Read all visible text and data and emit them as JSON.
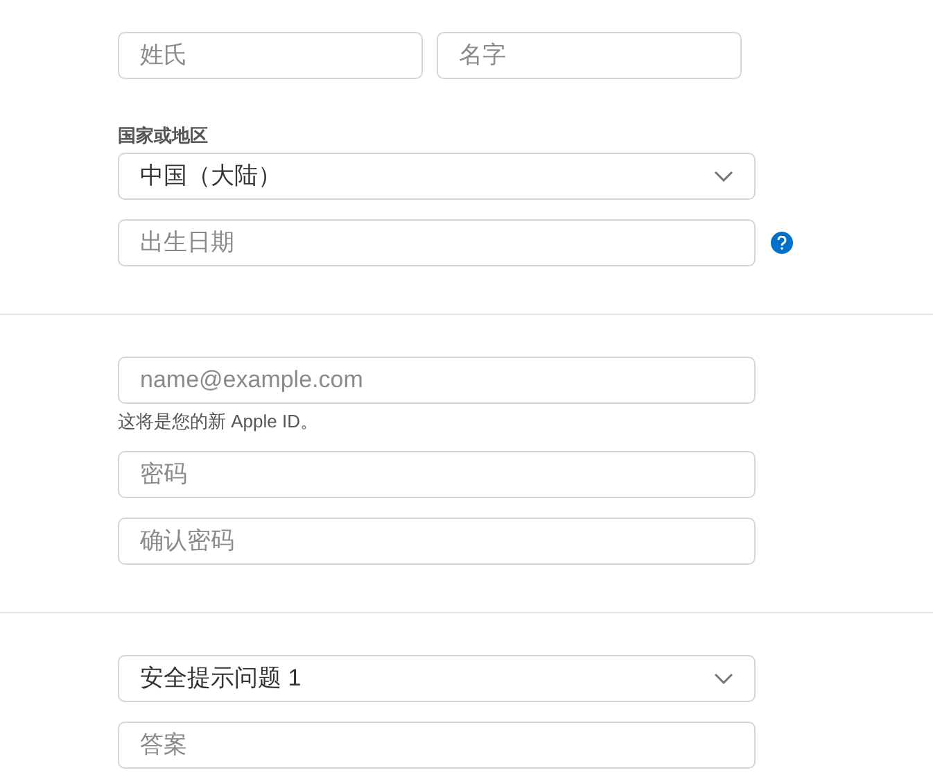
{
  "name_fields": [
    {
      "placeholder": "姓氏"
    },
    {
      "placeholder": "名字"
    }
  ],
  "country": {
    "label": "国家或地区",
    "value": "中国（大陆）"
  },
  "birthday": {
    "placeholder": "出生日期"
  },
  "account": {
    "email_placeholder": "name@example.com",
    "hint": "这将是您的新 Apple ID。",
    "password_placeholder": "密码",
    "confirm_placeholder": "确认密码"
  },
  "security": {
    "question": "安全提示问题 1",
    "answer_placeholder": "答案"
  }
}
